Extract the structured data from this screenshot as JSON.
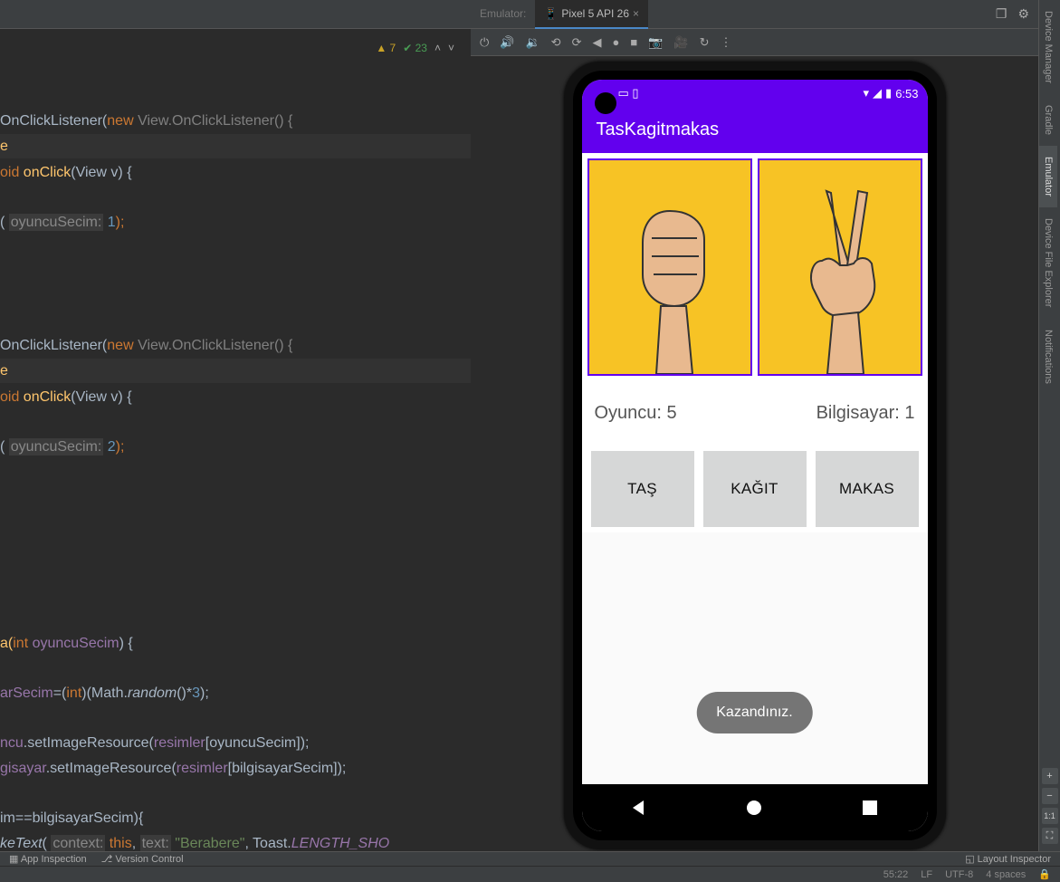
{
  "tabs": {
    "tool_label": "Emulator:",
    "device_tab": "Pixel 5 API 26"
  },
  "warnings": {
    "warn_count": "7",
    "ok_count": "23"
  },
  "code_lines": {
    "l1a": "OnClickListener(",
    "l1b": "new",
    "l1c": " View.OnClickListener() {",
    "l2": "e",
    "l3a": "oid ",
    "l3b": "onClick",
    "l3c": "(View v) {",
    "l4a": "( ",
    "l4p": "oyuncuSecim:",
    "l4b": " 1",
    "l4c": ");",
    "l5a": "OnClickListener(",
    "l5b": "new",
    "l5c": " View.OnClickListener() {",
    "l6": "e",
    "l7a": "oid ",
    "l7b": "onClick",
    "l7c": "(View v) {",
    "l8a": "( ",
    "l8p": "oyuncuSecim:",
    "l8b": " 2",
    "l8c": ");",
    "l9a": "a(",
    "l9b": "int ",
    "l9c": "oyuncuSecim",
    "l9d": ") {",
    "l10a": "arSecim",
    "l10b": "=(",
    "l10c": "int",
    "l10d": ")(Math.",
    "l10e": "random",
    "l10f": "()*",
    "l10g": "3",
    "l10h": ");",
    "l11a": "ncu",
    "l11b": ".setImageResource(",
    "l11c": "resimler",
    "l11d": "[oyuncuSecim]);",
    "l12a": "gisayar",
    "l12b": ".setImageResource(",
    "l12c": "resimler",
    "l12d": "[bilgisayarSecim]);",
    "l13": "im==bilgisayarSecim){",
    "l14a": "keText",
    "l14b": "( ",
    "l14p1": "context:",
    "l14c": " this",
    "l14d": ", ",
    "l14p2": "text:",
    "l14e": " \"Berabere\"",
    "l14f": ", Toast.",
    "l14g": "LENGTH_SHO"
  },
  "emulator": {
    "status_time": "6:53",
    "app_title": "TasKagitmakas",
    "player_label": "Oyuncu: 5",
    "cpu_label": "Bilgisayar: 1",
    "btn_rock": "TAŞ",
    "btn_paper": "KAĞIT",
    "btn_scissors": "MAKAS",
    "toast": "Kazandınız."
  },
  "right_tools": {
    "t1": "Device Manager",
    "t2": "Gradle",
    "t3": "Emulator",
    "t4": "Device File Explorer",
    "t5": "Notifications",
    "z1": "+",
    "z2": "−",
    "z3": "1:1",
    "z4": "⛶"
  },
  "bottom": {
    "b1": "App Inspection",
    "b2": "Version Control",
    "b3": "Layout Inspector",
    "s1": "55:22",
    "s2": "LF",
    "s3": "UTF-8",
    "s4": "4 spaces"
  }
}
